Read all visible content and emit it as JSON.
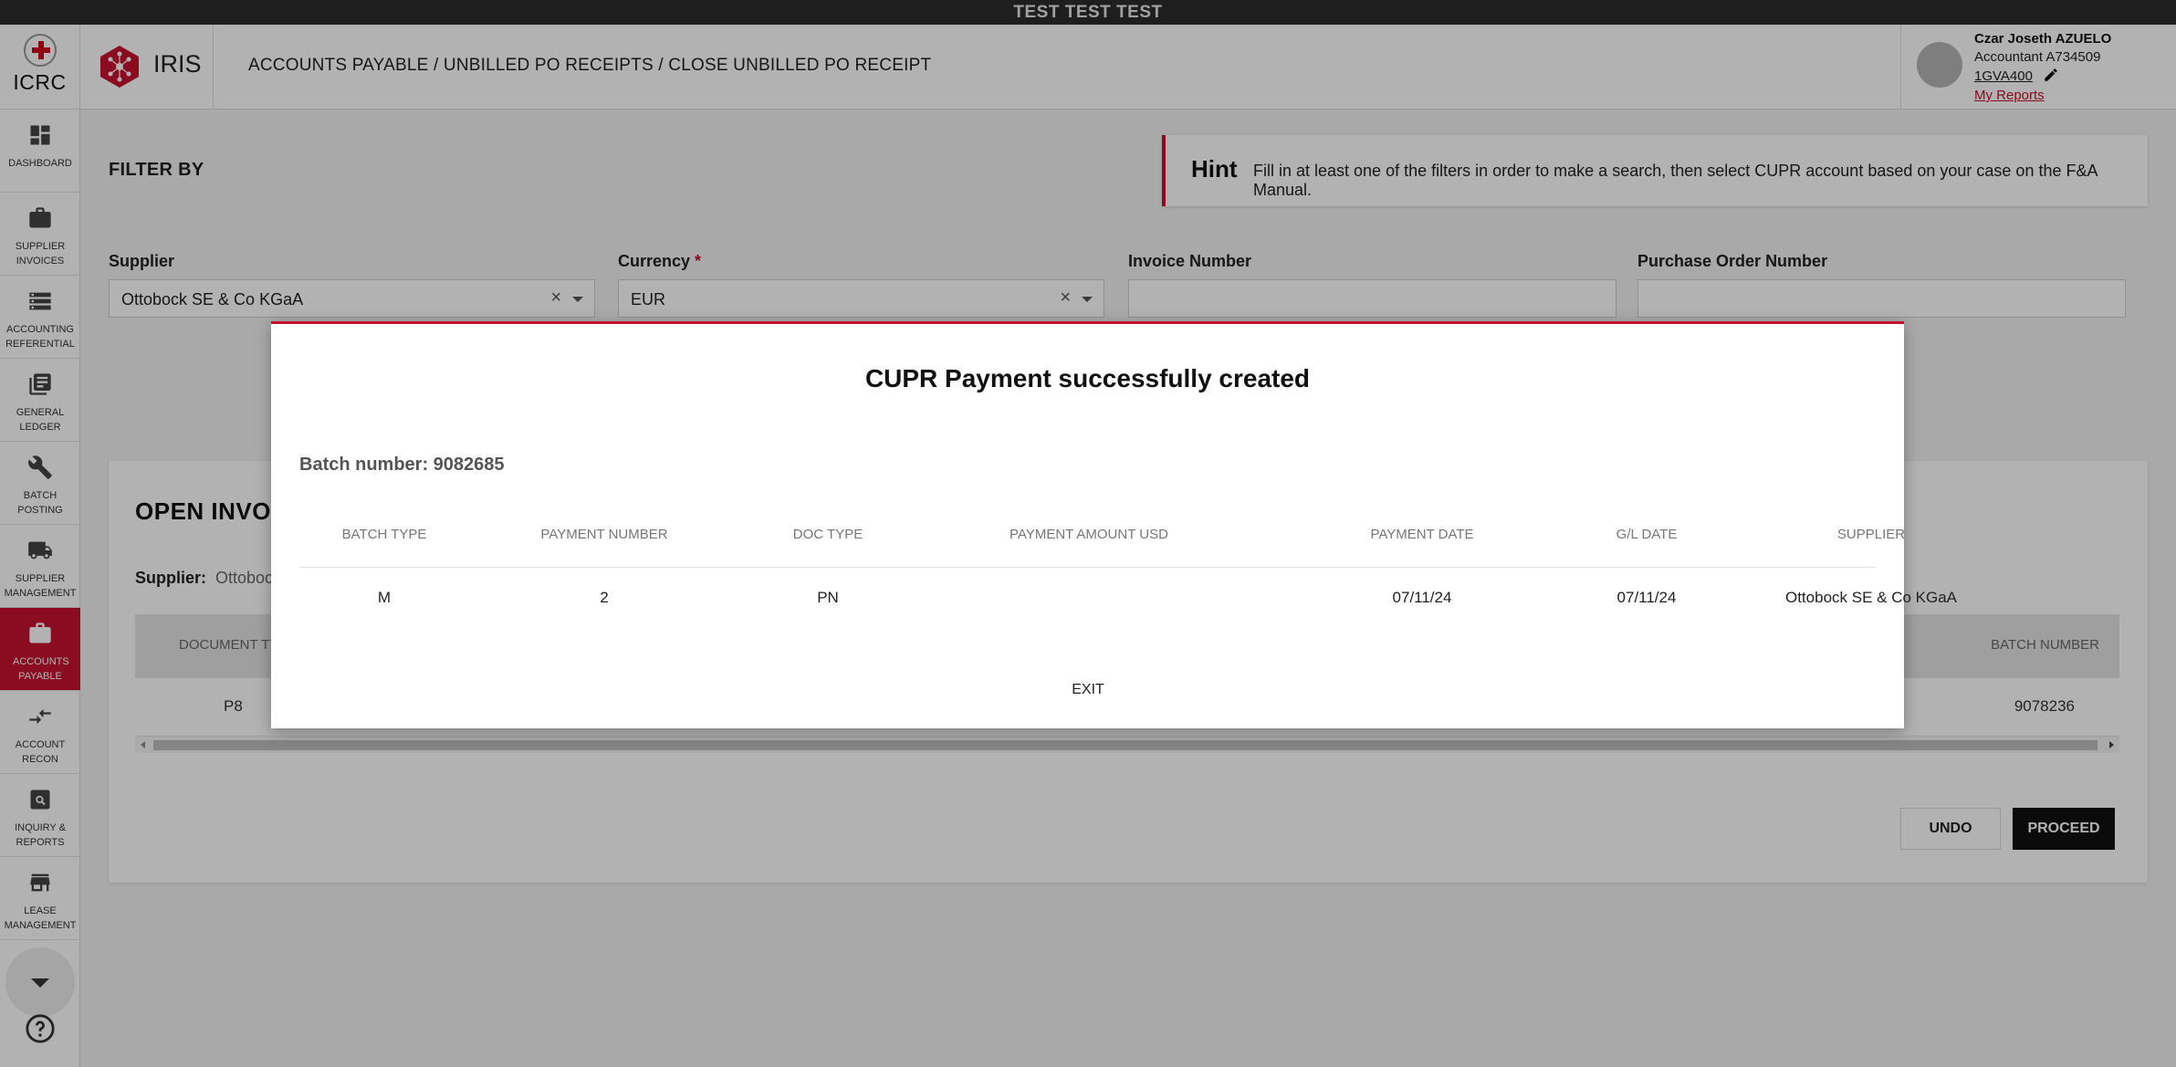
{
  "banner": "TEST TEST TEST",
  "header": {
    "org_name": "ICRC",
    "app_name": "IRIS",
    "breadcrumb": "ACCOUNTS PAYABLE / UNBILLED PO RECEIPTS / CLOSE UNBILLED PO RECEIPT",
    "user": {
      "name": "Czar Joseth AZUELO",
      "role": "Accountant A734509",
      "code": "1GVA400",
      "reports_link": "My Reports"
    }
  },
  "sidebar": {
    "items": [
      {
        "label": "DASHBOARD",
        "icon": "dashboard-icon"
      },
      {
        "label": "SUPPLIER INVOICES",
        "icon": "briefcase-icon"
      },
      {
        "label": "ACCOUNTING REFERENTIAL",
        "icon": "storage-icon"
      },
      {
        "label": "GENERAL LEDGER",
        "icon": "ledger-icon"
      },
      {
        "label": "BATCH POSTING",
        "icon": "wrench-icon"
      },
      {
        "label": "SUPPLIER MANAGEMENT",
        "icon": "truck-icon"
      },
      {
        "label": "ACCOUNTS PAYABLE",
        "icon": "briefcase-icon",
        "active": true
      },
      {
        "label": "ACCOUNT RECON",
        "icon": "compare-arrows-icon"
      },
      {
        "label": "INQUIRY & REPORTS",
        "icon": "search-report-icon"
      },
      {
        "label": "LEASE MANAGEMENT",
        "icon": "store-icon"
      }
    ]
  },
  "filters": {
    "title": "FILTER BY",
    "hint_title": "Hint",
    "hint_text": "Fill in at least one of the filters in order to make a search, then select CUPR account based on your case on the F&A Manual.",
    "supplier_label": "Supplier",
    "supplier_value": "Ottobock SE & Co KGaA",
    "currency_label": "Currency",
    "currency_required": "*",
    "currency_value": "EUR",
    "invoice_label": "Invoice Number",
    "invoice_value": "",
    "po_label": "Purchase Order Number",
    "po_value": ""
  },
  "results": {
    "title": "OPEN INVOIC",
    "supplier_label": "Supplier:",
    "supplier_value": "Ottobock",
    "col_doc_type": "DOCUMENT TY",
    "col_batch_number": "BATCH NUMBER",
    "row_doc_type": "P8",
    "row_batch_number": "9078236",
    "undo_label": "UNDO",
    "proceed_label": "PROCEED"
  },
  "modal": {
    "title": "CUPR Payment successfully created",
    "batch_line": "Batch number: 9082685",
    "columns": [
      "BATCH TYPE",
      "PAYMENT NUMBER",
      "DOC TYPE",
      "PAYMENT AMOUNT USD",
      "PAYMENT DATE",
      "G/L DATE",
      "SUPPLIER"
    ],
    "row": [
      "M",
      "2",
      "PN",
      "",
      "07/11/24",
      "07/11/24",
      "Ottobock SE & Co KGaA"
    ],
    "exit_label": "EXIT"
  },
  "colors": {
    "accent": "#c8102e",
    "banner": "#2b2b2b",
    "proceed": "#111111"
  }
}
